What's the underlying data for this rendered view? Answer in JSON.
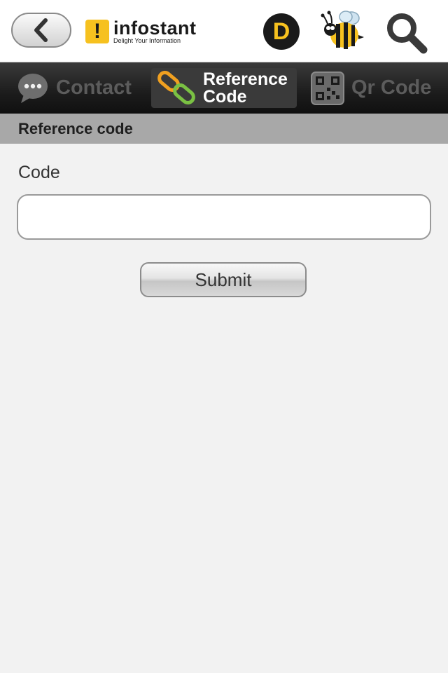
{
  "header": {
    "logo": {
      "name": "infostant",
      "tagline": "Delight Your Information",
      "mark": "!"
    },
    "d_badge": "D",
    "icons": [
      "back-arrow-icon",
      "d-badge-icon",
      "bee-icon",
      "search-icon"
    ]
  },
  "tabs": [
    {
      "label": "Contact",
      "icon": "chat-bubble-icon",
      "active": false
    },
    {
      "label_line1": "Reference",
      "label_line2": "Code",
      "icon": "chain-link-icon",
      "active": true
    },
    {
      "label": "Qr Code",
      "icon": "qr-code-icon",
      "active": false
    }
  ],
  "section": {
    "title": "Reference code"
  },
  "form": {
    "code_label": "Code",
    "code_value": "",
    "submit_label": "Submit"
  },
  "colors": {
    "accent_yellow": "#f6c11f",
    "tabbar_dark": "#1c1c1c",
    "section_gray": "#a8a8a8",
    "background": "#f2f2f2"
  }
}
